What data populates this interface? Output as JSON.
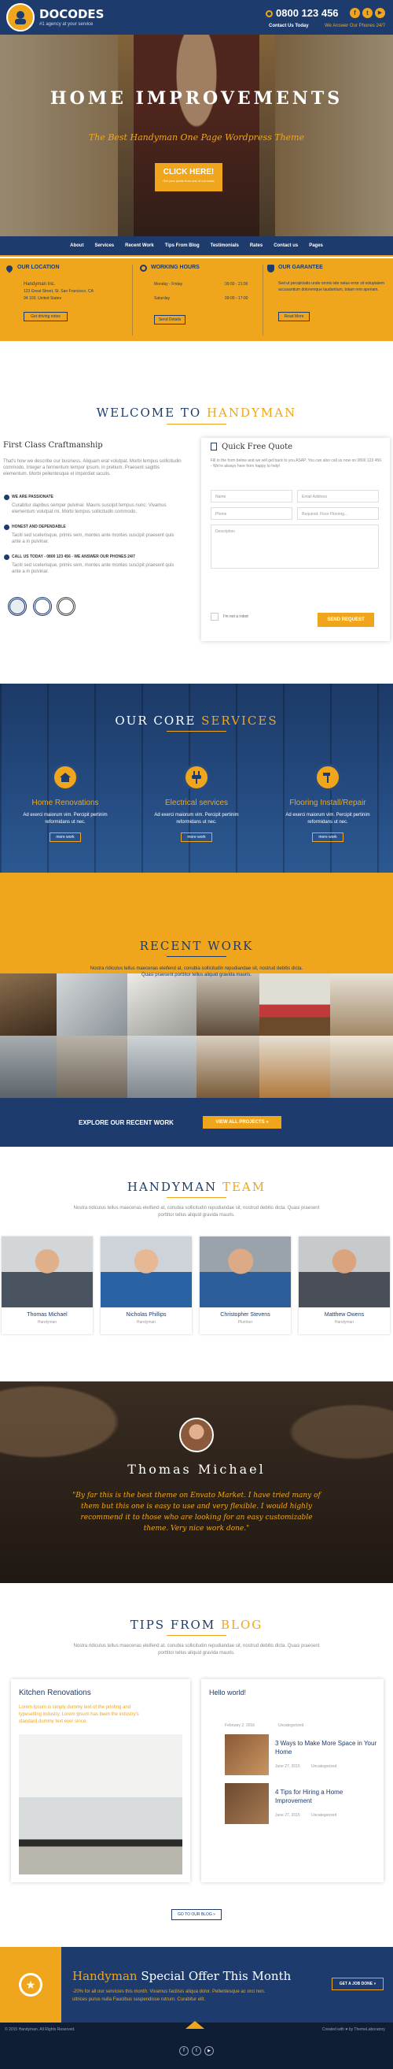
{
  "colors": {
    "accent": "#f0a61c",
    "navy": "#1d3c6d",
    "dark": "#0f1e35",
    "text": "#333333"
  },
  "header": {
    "logo": "DOCODES",
    "tagline": "#1 agency at your service",
    "phone": "0800 123 456",
    "contact_label": "Contact Us Today",
    "answer_label": "We Answer Our Phones 24/7",
    "social": [
      "facebook-icon",
      "twitter-icon",
      "youtube-icon"
    ]
  },
  "hero": {
    "title": "HOME IMPROVEMENTS",
    "subtitle": "The Best Handyman One Page Wordpress Theme",
    "cta": "CLICK HERE!",
    "cta_sub": "Get your quote from one of our tasks"
  },
  "nav": [
    "About",
    "Services",
    "Recent Work",
    "Tips From Blog",
    "Testimonials",
    "Rates",
    "Contact us",
    "Pages"
  ],
  "info": [
    {
      "title": "OUR LOCATION",
      "icon": "pin-icon",
      "lines": [
        "Handyman Inc.",
        "123 Great Street, St. San Francisco, CA",
        "94 103, United States"
      ],
      "btn": "Get driving notes"
    },
    {
      "title": "WORKING HOURS",
      "icon": "clock-icon",
      "rows": [
        [
          "Monday - Friday",
          "09:00 - 21:00"
        ],
        [
          "Saturday",
          "09:00 - 17:00"
        ]
      ],
      "btn": "Send Details"
    },
    {
      "title": "OUR GARANTEE",
      "icon": "shield-icon",
      "lines": [
        "Sed ut perspiciatis unde omnis iste natus error sit voluptatem accusantium doloremque laudantium, totam rem aperiam."
      ],
      "btn": "Read More"
    }
  ],
  "welcome": {
    "title_a": "WELCOME TO ",
    "title_b": "HANDYMAN",
    "heading": "First Class Craftmanship",
    "body": "That's how we describe our business. Aliquam erat volutpat. Morbi tempus sollicitudin commodo. Integer a fermentum tempor ipsum, in pretium. Praesent sagittis elementum. Morbi pellentesque et imperdiet iaculis.",
    "points": [
      {
        "t": "WE ARE PASSIONATE",
        "d": "Curabitur dapibus semper pulvinar. Mauris suscipit tempus nunc. Vivamus elementum volutpat mi. Morbi tempus sollicitudin commodo."
      },
      {
        "t": "HONEST AND DEPENDABLE",
        "d": "Taciti sed scelerisque, primis sem, montes ante montes suscipit praesent quis ante a in pulvinar."
      },
      {
        "t": "CALL US TODAY - 0800 123 456 - WE ANSWER OUR PHONES 24/7",
        "d": "Taciti sed scelerisque, primis sem, montes ante montes suscipit praesent quis ante a in pulvinar."
      }
    ]
  },
  "quote": {
    "title": "Quick Free Quote",
    "desc": "Fill in the form below and we will get back to you ASAP. You can also call us now on 0800 123 456 - We're always here from happy to help!",
    "name": "Name",
    "email": "Email Address",
    "phone": "Phone",
    "service": "Required: Floor Flooring...",
    "description": "Description",
    "captcha": "I'm not a robot",
    "submit": "SEND REQUEST"
  },
  "services": {
    "title_a": "OUR CORE ",
    "title_b": "SERVICES",
    "items": [
      {
        "name": "Home Renovations",
        "icon": "house-icon",
        "desc": "Ad exerci maiorum vim. Percipit pertinim reformidans ut nec.",
        "btn": "more work"
      },
      {
        "name": "Electrical services",
        "icon": "plug-icon",
        "desc": "Ad exerci maiorum vim. Percipit pertinim reformidans ut nec.",
        "btn": "more work"
      },
      {
        "name": "Flooring Install/Repair",
        "icon": "hammer-icon",
        "desc": "Ad exerci maiorum vim. Percipit pertinim reformidans ut nec.",
        "btn": "more work"
      }
    ]
  },
  "work": {
    "title": "RECENT WORK",
    "desc": "Nostra ridiculus tellus maecenas eleifend at, conubia sollicitudin repudiandae sit, nostrud debitis dicta. Quasi praesent porttitor tellus aliquid gravida mauris.",
    "banner": "EXPLORE OUR RECENT WORK",
    "banner_btn": "VIEW ALL PROJECTS »"
  },
  "team": {
    "title_a": "HANDYMAN ",
    "title_b": "TEAM",
    "desc": "Nostra ridiculus tellus maecenas eleifend at, conubia sollicitudin repudiandae sit, nostrud debitis dicta. Quasi praesent porttitor tellus aliquid gravida mauris.",
    "members": [
      {
        "name": "Thomas Michael",
        "role": "Handyman"
      },
      {
        "name": "Nicholas Phillips",
        "role": "Handyman"
      },
      {
        "name": "Christopher Stevens",
        "role": "Plumber"
      },
      {
        "name": "Matthew Owens",
        "role": "Handyman"
      }
    ]
  },
  "testimonial": {
    "name": "Thomas Michael",
    "quote": "\"By far this is the best theme on Envato Market. I have tried many of them but this one is easy to use and very flexible. I would highly recommend it to those who are looking for an easy customizable theme. Very nice work done.\""
  },
  "blog": {
    "title_a": "TIPS FROM ",
    "title_b": "BLOG",
    "desc": "Nostra ridiculus tellus maecenas eleifend at, conubia sollicitudin repudiandae sit, nostrud debitis dicta. Quasi praesent porttitor tellus aliquid gravida mauris.",
    "feature": {
      "title": "Kitchen Renovations",
      "text": "Lorem Ipsum is simply dummy text of the printing and typesetting industry. Lorem Ipsum has been the industry's standard dummy text ever since."
    },
    "side_title": "Hello world!",
    "posts": [
      {
        "date": "February 2, 2016",
        "cat": "Uncategorized",
        "title": "3 Ways to Make More Space in Your Home",
        "date2": "June 27, 2015",
        "cat2": "Uncategorized"
      },
      {
        "title": "4 Tips for Hiring a Home Improvement",
        "date2": "June 27, 2015",
        "cat2": "Uncategorized"
      }
    ],
    "btn": "GO TO OUR BLOG »"
  },
  "offer": {
    "title_a": "Handyman ",
    "title_b": "Special Offer This Month",
    "line1": "-20% for all our servicies this month. Vivamus facilisis aliqua dolor. Pellentesque ac orci non.",
    "line2": "ultrices purus nulla Faucibus suspendisse rutrum. Curabitur elit.",
    "btn": "GET A JOB DONE »"
  },
  "footer": {
    "copy": "© 2015 Handyman. All Rights Reserved.",
    "credit": "Created with ♥ by ThemeLaboratory"
  }
}
